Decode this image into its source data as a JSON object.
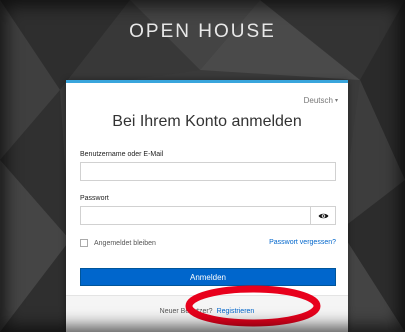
{
  "header": {
    "app_title": "OPEN HOUSE"
  },
  "login_card": {
    "language": "Deutsch",
    "title": "Bei Ihrem Konto anmelden",
    "username_label": "Benutzername oder E-Mail",
    "username_value": "",
    "password_label": "Passwort",
    "password_value": "",
    "remember_label": "Angemeldet bleiben",
    "remember_checked": false,
    "forgot_link": "Passwort vergessen?",
    "login_button": "Anmelden",
    "footer_text": "Neuer Benutzer?",
    "register_link": "Registrieren"
  },
  "colors": {
    "accent": "#0066cc",
    "card_border_top": "#39a5dc",
    "annotation_circle": "#e8001c",
    "background": "#3a3a3a"
  },
  "icons": {
    "password_toggle": "eye-icon",
    "language_caret": "caret-down-icon"
  }
}
